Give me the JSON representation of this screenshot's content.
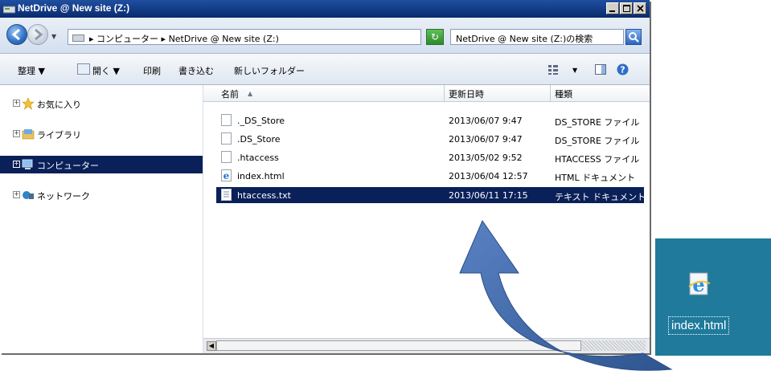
{
  "window": {
    "title": "NetDrive @ New site (Z:)",
    "controls": [
      "_",
      "□",
      "×"
    ]
  },
  "address": {
    "separator": "▸",
    "crumbs": [
      "コンピューター",
      "NetDrive @ New site (Z:)"
    ],
    "search_placeholder": "NetDrive @ New site (Z:)の検索"
  },
  "toolbar": {
    "organize": "整理 ▼",
    "open": "開く ▼",
    "print": "印刷",
    "burn": "書き込む",
    "new_folder": "新しいフォルダー"
  },
  "sidebar": {
    "items": [
      {
        "label": "お気に入り"
      },
      {
        "label": "ライブラリ"
      },
      {
        "label": "コンピューター"
      },
      {
        "label": "ネットワーク"
      }
    ]
  },
  "columns": {
    "name": "名前",
    "date": "更新日時",
    "type": "種類"
  },
  "files": [
    {
      "name": "._DS_Store",
      "date": "2013/06/07 9:47",
      "type": "DS_STORE ファイル"
    },
    {
      "name": ".DS_Store",
      "date": "2013/06/07 9:47",
      "type": "DS_STORE ファイル"
    },
    {
      "name": ".htaccess",
      "date": "2013/05/02 9:52",
      "type": "HTACCESS ファイル"
    },
    {
      "name": "index.html",
      "date": "2013/06/04 12:57",
      "type": "HTML ドキュメント"
    },
    {
      "name": "htaccess.txt",
      "date": "2013/06/11 17:15",
      "type": "テキスト ドキュメント"
    }
  ],
  "desktop": {
    "icon_label": "index.html"
  },
  "colors": {
    "selection": "#0a2059",
    "desktop": "#1f7a9c",
    "arrow": "#3a63a8"
  }
}
